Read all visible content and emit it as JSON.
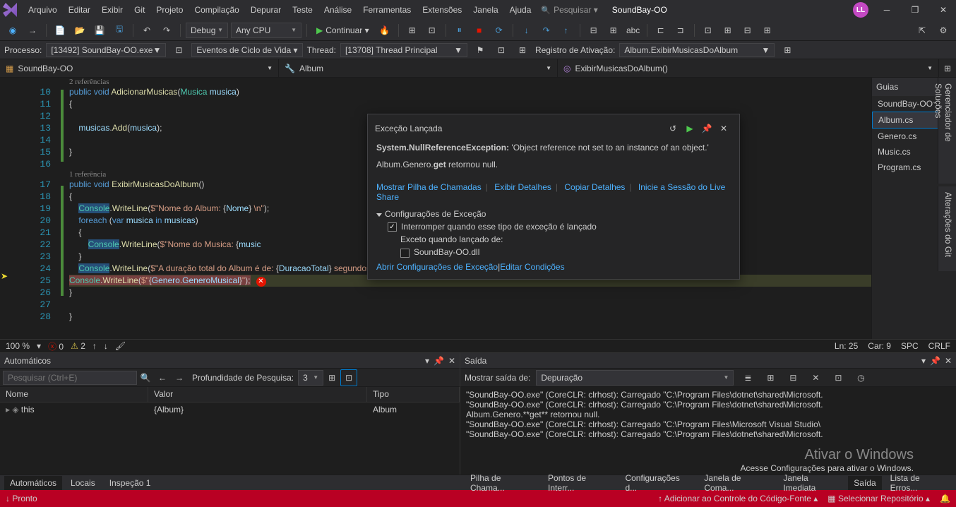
{
  "menu": {
    "items": [
      "Arquivo",
      "Editar",
      "Exibir",
      "Git",
      "Projeto",
      "Compilação",
      "Depurar",
      "Teste",
      "Análise",
      "Ferramentas",
      "Extensões",
      "Janela",
      "Ajuda"
    ],
    "search": "Pesquisar ▾",
    "doc": "SoundBay-OO",
    "avatar": "LL"
  },
  "toolbar": {
    "config": "Debug",
    "platform": "Any CPU",
    "continue": "Continuar ▾"
  },
  "debugbar": {
    "process_lbl": "Processo:",
    "process": "[13492] SoundBay-OO.exe",
    "events": "Eventos de Ciclo de Vida ▾",
    "thread_lbl": "Thread:",
    "thread": "[13708] Thread Principal",
    "stack_lbl": "Registro de Ativação:",
    "stack": "Album.ExibirMusicasDoAlbum"
  },
  "nav": {
    "a": "SoundBay-OO",
    "b": "Album",
    "c": "ExibirMusicasDoAlbum()"
  },
  "guides": {
    "title": "Guias",
    "proj": "SoundBay-OO",
    "files": [
      "Album.cs",
      "Genero.cs",
      "Music.cs",
      "Program.cs"
    ]
  },
  "vtabs": {
    "a": "Gerenciador de Soluções",
    "b": "Alterações do Git"
  },
  "lines": [
    "10",
    "11",
    "12",
    "13",
    "14",
    "15",
    "16",
    "17",
    "18",
    "19",
    "20",
    "21",
    "22",
    "23",
    "24",
    "25",
    "26",
    "27",
    "28"
  ],
  "codelens": {
    "a": "2 referências",
    "b": "1 referência"
  },
  "exception": {
    "title": "Exceção Lançada",
    "name": "System.NullReferenceException:",
    "msg": "'Object reference not set to an instance of an object.'",
    "detail": "Album.Genero.get retornou null.",
    "l1": "Mostrar Pilha de Chamadas",
    "l2": "Exibir Detalhes",
    "l3": "Copiar Detalhes",
    "l4": "Inicie a Sessão do Live Share",
    "cfg": "Configurações de Exceção",
    "cb1": "Interromper quando esse tipo de exceção é lançado",
    "except": "Exceto quando lançado de:",
    "dll": "SoundBay-OO.dll",
    "l5": "Abrir Configurações de Exceção",
    "l6": "Editar Condições"
  },
  "status": {
    "zoom": "100 %",
    "err": "0",
    "warn": "2",
    "ln": "Ln: 25",
    "col": "Car: 9",
    "spc": "SPC",
    "crlf": "CRLF"
  },
  "autos": {
    "title": "Automáticos",
    "search_ph": "Pesquisar (Ctrl+E)",
    "depth_lbl": "Profundidade de Pesquisa:",
    "depth": "3",
    "cols": [
      "Nome",
      "Valor",
      "Tipo"
    ],
    "row": {
      "name": "this",
      "value": "{Album}",
      "type": "Album"
    }
  },
  "output": {
    "title": "Saída",
    "from_lbl": "Mostrar saída de:",
    "from": "Depuração",
    "lines": [
      "\"SoundBay-OO.exe\" (CoreCLR: clrhost): Carregado \"C:\\Program Files\\dotnet\\shared\\Microsoft.",
      "\"SoundBay-OO.exe\" (CoreCLR: clrhost): Carregado \"C:\\Program Files\\dotnet\\shared\\Microsoft.",
      "Album.Genero.**get** retornou null.",
      "",
      "\"SoundBay-OO.exe\" (CoreCLR: clrhost): Carregado \"C:\\Program Files\\Microsoft Visual Studio\\",
      "\"SoundBay-OO.exe\" (CoreCLR: clrhost): Carregado \"C:\\Program Files\\dotnet\\shared\\Microsoft."
    ]
  },
  "tabs_left": [
    "Automáticos",
    "Locais",
    "Inspeção 1"
  ],
  "tabs_right": [
    "Pilha de Chama...",
    "Pontos de Interr...",
    "Configurações d...",
    "Janela de Coma...",
    "Janela Imediata",
    "Saída",
    "Lista de Erros..."
  ],
  "botbar": {
    "ready": "Pronto",
    "add": "Adicionar ao Controle do Código-Fonte ▴",
    "sel": "Selecionar Repositório ▴"
  },
  "watermark": {
    "t1": "Ativar o Windows",
    "t2": "Acesse Configurações para ativar o Windows."
  }
}
